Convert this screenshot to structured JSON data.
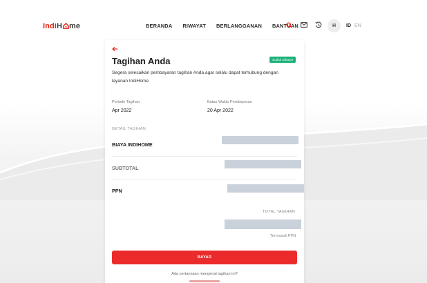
{
  "brand": {
    "logo_part1": "Indi",
    "logo_part2": "H",
    "logo_part3": "me"
  },
  "nav": {
    "items": [
      {
        "label": "BERANDA"
      },
      {
        "label": "RIWAYAT"
      },
      {
        "label": "BERLANGGANAN"
      },
      {
        "label": "BANTUAN"
      }
    ],
    "avatar_initial": "H",
    "lang_active": "ID",
    "lang_inactive": "EN"
  },
  "invoice": {
    "title": "Tagihan Anda",
    "status_badge": "Sudah Dibayar",
    "description": "Segera selesaikan pembayaran tagihan Anda agar selalu dapat terhubung dengan layanan IndiHome",
    "period_label": "Periode Tagihan",
    "period_value": "Apr 2022",
    "due_label": "Batas Waktu Pembayaran",
    "due_value": "20 Apr 2022",
    "detail_section": "DETAIL TAGIHAN",
    "rows": [
      {
        "label": "BIAYA INDIHOME"
      },
      {
        "label": "SUBTOTAL"
      },
      {
        "label": "PPN"
      }
    ],
    "total_label": "TOTAL TAGIHAN",
    "total_note": "Termasuk PPN",
    "pay_button": "BAYAR",
    "question": "Ada pertanyaan mengenai tagihan ini?"
  },
  "colors": {
    "accent": "#e42313",
    "pay": "#eb2b2b",
    "paid_badge": "#1bb27a"
  },
  "icons": [
    "search-icon",
    "mail-icon",
    "history-icon",
    "back-arrow-icon"
  ]
}
